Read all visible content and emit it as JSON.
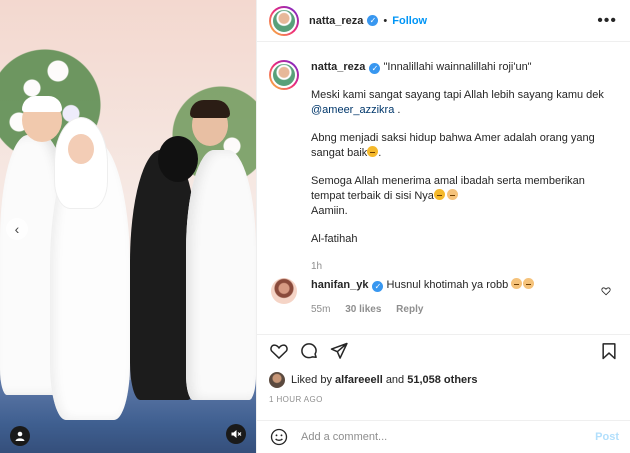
{
  "post_header": {
    "username": "natta_reza",
    "separator": "•",
    "follow_label": "Follow",
    "more_icon": "more-horizontal-icon"
  },
  "caption": {
    "username": "natta_reza",
    "title": "\"Innalillahi wainnalillahi roji'un\"",
    "para1_before": "Meski kami sangat sayang tapi Allah lebih sayang kamu dek",
    "para1_mention": "@ameer_azzikra",
    "para1_after": " .",
    "para2": "Abng menjadi saksi hidup bahwa Amer adalah orang yang sangat baik",
    "para3": "Semoga Allah menerima amal ibadah serta memberikan tempat terbaik di sisi Nya",
    "para3b": "Aamiin.",
    "para4": "Al-fatihah",
    "time": "1h"
  },
  "reply": {
    "username": "hanifan_yk",
    "text": "Husnul khotimah ya robb",
    "time": "55m",
    "likes": "30 likes",
    "reply_label": "Reply"
  },
  "likes": {
    "prefix": "Liked by",
    "user": "alfareeell",
    "conj": "and",
    "others": "51,058 others"
  },
  "posted_time": "1 hour ago",
  "comment_box": {
    "placeholder": "Add a comment...",
    "post_label": "Post"
  },
  "colors": {
    "accent": "#0095f6",
    "verified": "#3897f0",
    "muted": "#8e8e8e",
    "post_disabled": "#b2dffc"
  }
}
